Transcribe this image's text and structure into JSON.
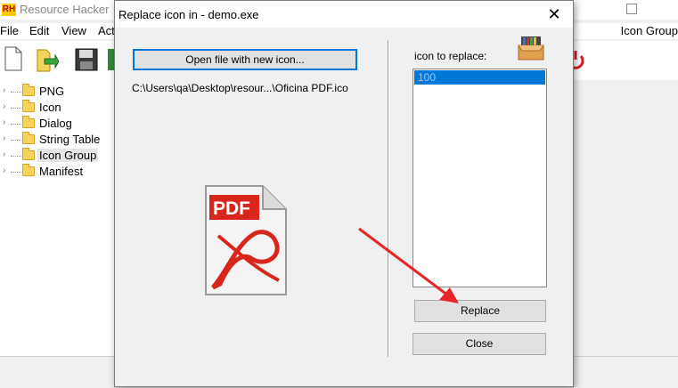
{
  "app": {
    "title": "Resource Hacker",
    "logo_text": "RH",
    "menu": [
      "File",
      "Edit",
      "View",
      "Act"
    ],
    "right_label": "Icon Group"
  },
  "tree": {
    "items": [
      {
        "label": "PNG",
        "selected": false
      },
      {
        "label": "Icon",
        "selected": false
      },
      {
        "label": "Dialog",
        "selected": false
      },
      {
        "label": "String Table",
        "selected": false
      },
      {
        "label": "Icon Group",
        "selected": true
      },
      {
        "label": "Manifest",
        "selected": false
      }
    ]
  },
  "dialog": {
    "title": "Replace icon in - demo.exe",
    "close_glyph": "✕",
    "open_button": "Open file with new icon...",
    "file_path": "C:\\Users\\qa\\Desktop\\resour...\\Oficina PDF.ico",
    "icon_list_label": "icon to replace:",
    "icon_list_items": [
      "100"
    ],
    "replace_button": "Replace",
    "close_button": "Close",
    "preview_text": "PDF"
  },
  "colors": {
    "accent": "#0078d7",
    "arrow": "#e8262a",
    "pdf_red": "#d9261c"
  },
  "icons": [
    "new-file-icon",
    "open-file-icon",
    "save-icon",
    "compile-icon",
    "power-icon",
    "resource-box-icon",
    "pdf-file-icon"
  ]
}
